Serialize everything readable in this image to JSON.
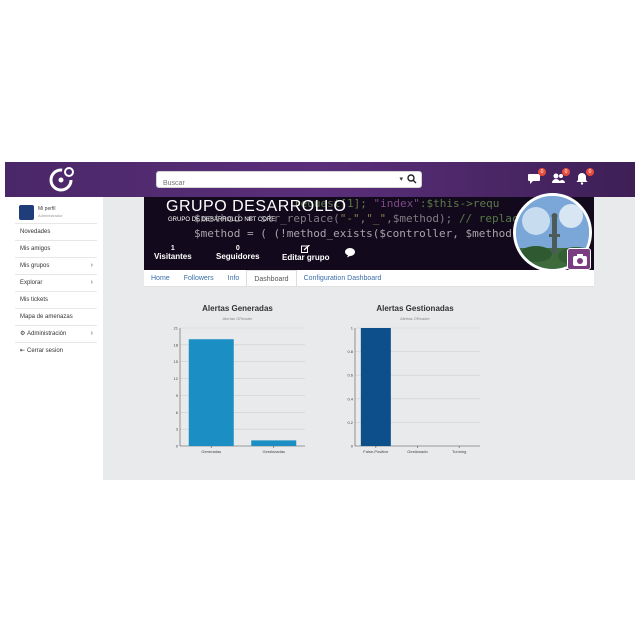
{
  "header": {
    "search_placeholder": "Buscar",
    "notifications": [
      {
        "icon": "chat-icon",
        "count": "0"
      },
      {
        "icon": "friends-icon",
        "count": "0"
      },
      {
        "icon": "bell-icon",
        "count": "0"
      }
    ]
  },
  "sidebar": {
    "profile": {
      "name": "Mi perfil",
      "role": "Administrador"
    },
    "items": [
      {
        "label": "Novedades",
        "has_chevron": false
      },
      {
        "label": "Mis amigos",
        "has_chevron": false
      },
      {
        "label": "Mis grupos",
        "has_chevron": true
      },
      {
        "label": "Explorar",
        "has_chevron": true
      },
      {
        "label": "Mis tickets",
        "has_chevron": false
      },
      {
        "label": "Mapa de amenazas",
        "has_chevron": false
      },
      {
        "label": "Administración",
        "has_chevron": true,
        "icon": "gears-icon"
      },
      {
        "label": "Cerrar sesion",
        "has_chevron": false,
        "icon": "logout-icon"
      }
    ]
  },
  "group": {
    "title": "GRUPO DESARROLLO",
    "subtitle": "GRUPO DE DESARROLLO NET CORE",
    "stats": [
      {
        "value": "1",
        "label": "Visitantes"
      },
      {
        "value": "0",
        "label": "Seguidores"
      }
    ],
    "edit_label": "Editar grupo"
  },
  "tabs": [
    {
      "label": "Home",
      "active": false
    },
    {
      "label": "Followers",
      "active": false
    },
    {
      "label": "Info",
      "active": false
    },
    {
      "label": "Dashboard",
      "active": true
    },
    {
      "label": "Configuration Dashboard",
      "active": false
    }
  ],
  "chart_data": [
    {
      "type": "bar",
      "title": "Alertas Generadas",
      "subtitle": "Alertas OReader",
      "categories": [
        "Generadas",
        "Gestionadas"
      ],
      "values": [
        19,
        1
      ],
      "ylim": [
        0,
        21
      ],
      "yticks": [
        0,
        3,
        6,
        9,
        12,
        15,
        18,
        21
      ],
      "color": "#1b8fc4",
      "grid": true
    },
    {
      "type": "bar",
      "title": "Alertas Gestionadas",
      "subtitle": "Alertas OReader",
      "categories": [
        "False-Positive",
        "Gestionado",
        "Tunning"
      ],
      "values": [
        1,
        0,
        0
      ],
      "ylim": [
        0,
        1
      ],
      "yticks": [
        0,
        0.2,
        0.4,
        0.6,
        0.8,
        1
      ],
      "color": "#0d4f8a",
      "grid": true
    }
  ]
}
